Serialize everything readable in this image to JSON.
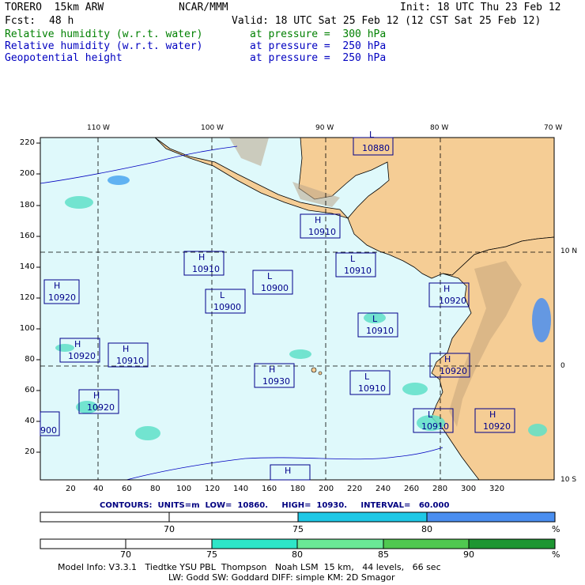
{
  "header": {
    "model": "TORERO  15km ARW",
    "org": "NCAR/MMM",
    "init": "Init: 18 UTC Thu 23 Feb 12",
    "fcst_label": "Fcst:",
    "fcst_value": "48 h",
    "valid": "Valid: 18 UTC Sat 25 Feb 12 (12 CST Sat 25 Feb 12)",
    "fields": [
      {
        "name": "Relative humidity (w.r.t. water)",
        "level": "at pressure =  300 hPa",
        "color": "#008000"
      },
      {
        "name": "Relative humidity (w.r.t. water)",
        "level": "at pressure =  250 hPa",
        "color": "#0000c0"
      },
      {
        "name": "Geopotential height",
        "level": "at pressure =  250 hPa",
        "color": "#0000c0"
      }
    ]
  },
  "map": {
    "top_lon_labels": [
      "110 W",
      "100 W",
      "90 W",
      "80 W",
      "70 W"
    ],
    "right_lat_labels": [
      "10 N",
      "0",
      "10 S"
    ],
    "left_ticks": [
      "220",
      "200",
      "180",
      "160",
      "140",
      "120",
      "100",
      "80",
      "60",
      "40",
      "20"
    ],
    "bottom_ticks": [
      "20",
      "40",
      "60",
      "80",
      "100",
      "120",
      "140",
      "160",
      "180",
      "200",
      "220",
      "240",
      "260",
      "280",
      "300",
      "320"
    ],
    "ocean_color": "#dff9fb",
    "land_color": "#f5cd95",
    "systems": [
      {
        "type": "L",
        "value": "10880"
      },
      {
        "type": "H",
        "value": "10910"
      },
      {
        "type": "H",
        "value": "10910"
      },
      {
        "type": "L",
        "value": "10910"
      },
      {
        "type": "L",
        "value": "10900"
      },
      {
        "type": "H",
        "value": "10920"
      },
      {
        "type": "L",
        "value": "10900"
      },
      {
        "type": "H",
        "value": "10920"
      },
      {
        "type": "L",
        "value": "10910"
      },
      {
        "type": "H",
        "value": "10920"
      },
      {
        "type": "H",
        "value": "10910"
      },
      {
        "type": "H",
        "value": "10920"
      },
      {
        "type": "H",
        "value": "10930"
      },
      {
        "type": "L",
        "value": "10910"
      },
      {
        "type": "H",
        "value": "10920"
      },
      {
        "type": "L",
        "value": "10910"
      },
      {
        "type": "H",
        "value": "10920"
      },
      {
        "type": "",
        "value": "900"
      },
      {
        "type": "H",
        "value": ""
      }
    ]
  },
  "contours_line": "CONTOURS:  UNITS=m  LOW=  10860.     HIGH=  10930.     INTERVAL=   60.000",
  "colorbar1": {
    "labels": [
      "70",
      "75",
      "80",
      "%"
    ],
    "colors": [
      "#ffffff",
      "#ffffff",
      "#1ec8e6",
      "#4a8ef0"
    ]
  },
  "colorbar2": {
    "labels": [
      "70",
      "75",
      "80",
      "85",
      "90",
      "%"
    ],
    "colors": [
      "#ffffff",
      "#ffffff",
      "#2ee6c8",
      "#6ae896",
      "#50c850",
      "#1e9632"
    ]
  },
  "footer": {
    "line1": "Model Info: V3.3.1   Tiedtke YSU PBL  Thompson   Noah LSM  15 km,   44 levels,   66 sec",
    "line2": "LW: Godd SW: Goddard DIFF: simple KM: 2D Smagor"
  }
}
